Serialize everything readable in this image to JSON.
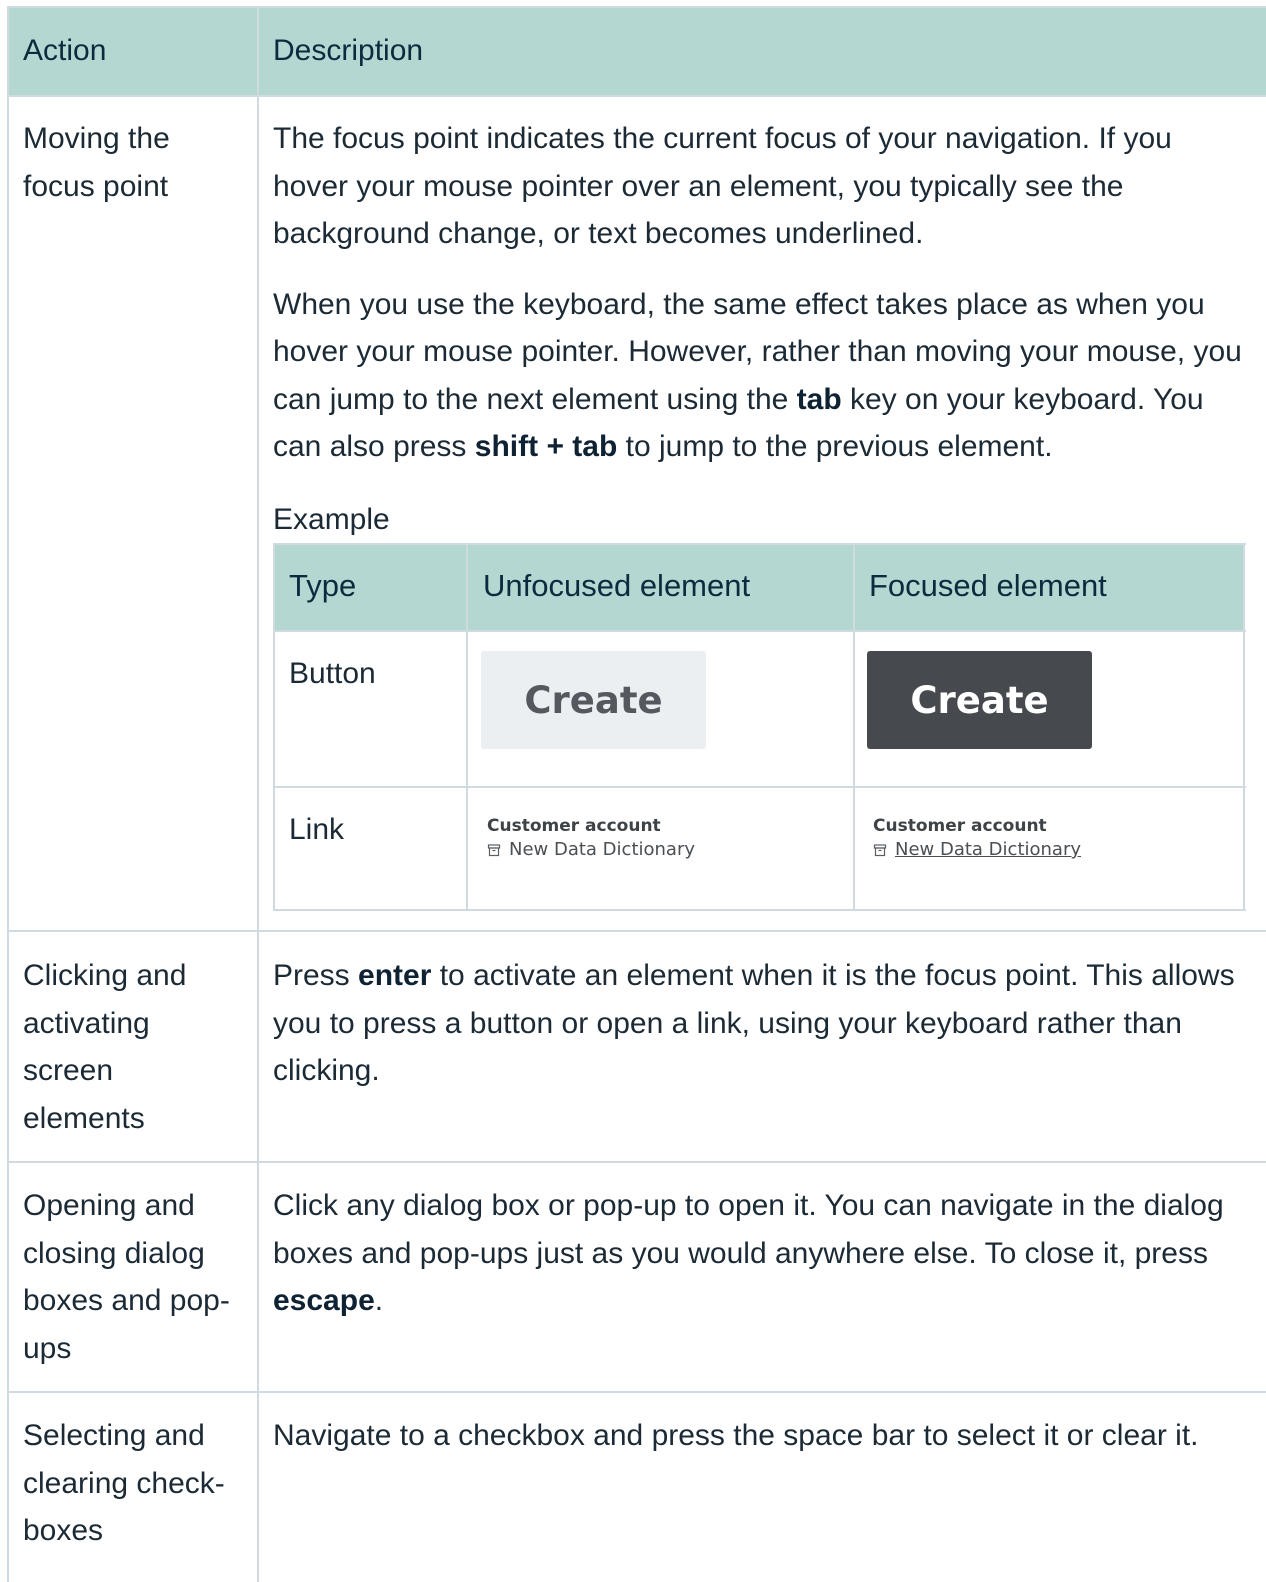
{
  "table": {
    "headers": {
      "action": "Action",
      "description": "Description"
    },
    "rows": [
      {
        "action": "Moving the focus point",
        "desc_p1": "The focus point indicates the current focus of your navigation. If you hover your mouse pointer over an element, you typically see the background change, or text becomes underlined.",
        "desc_p2_a": "When you use the keyboard, the same effect takes place as when you hover your mouse pointer. However, rather than moving your mouse, you can jump to the next element using the ",
        "desc_p2_k1": "tab",
        "desc_p2_b": " key on your keyboard. You can also press ",
        "desc_p2_k2": "shift + tab",
        "desc_p2_c": " to jump to the previous element.",
        "example_label": "Example"
      },
      {
        "action": "Clicking and activating screen elements",
        "desc_a": "Press ",
        "desc_k": "enter",
        "desc_b": " to activate an element when it is the focus point. This allows you to press a button or open a link, using your keyboard rather than clicking."
      },
      {
        "action": "Opening and closing dialog boxes and pop-ups",
        "desc_a": "Click any dialog box or pop-up to open it. You can navigate in the dialog boxes and pop-ups just as you would anywhere else. To close it, press ",
        "desc_k": "escape",
        "desc_b": "."
      },
      {
        "action": "Selecting and clearing check-boxes",
        "desc": "Navigate to a checkbox and press the space bar to select it or clear it."
      }
    ]
  },
  "example": {
    "headers": {
      "type": "Type",
      "unfocused": "Unfocused element",
      "focused": "Focused element"
    },
    "button_row": {
      "type": "Button",
      "button_label": "Create"
    },
    "link_row": {
      "type": "Link",
      "title": "Customer account",
      "link_text": "New Data Dictionary",
      "icon": "archive-icon"
    }
  }
}
